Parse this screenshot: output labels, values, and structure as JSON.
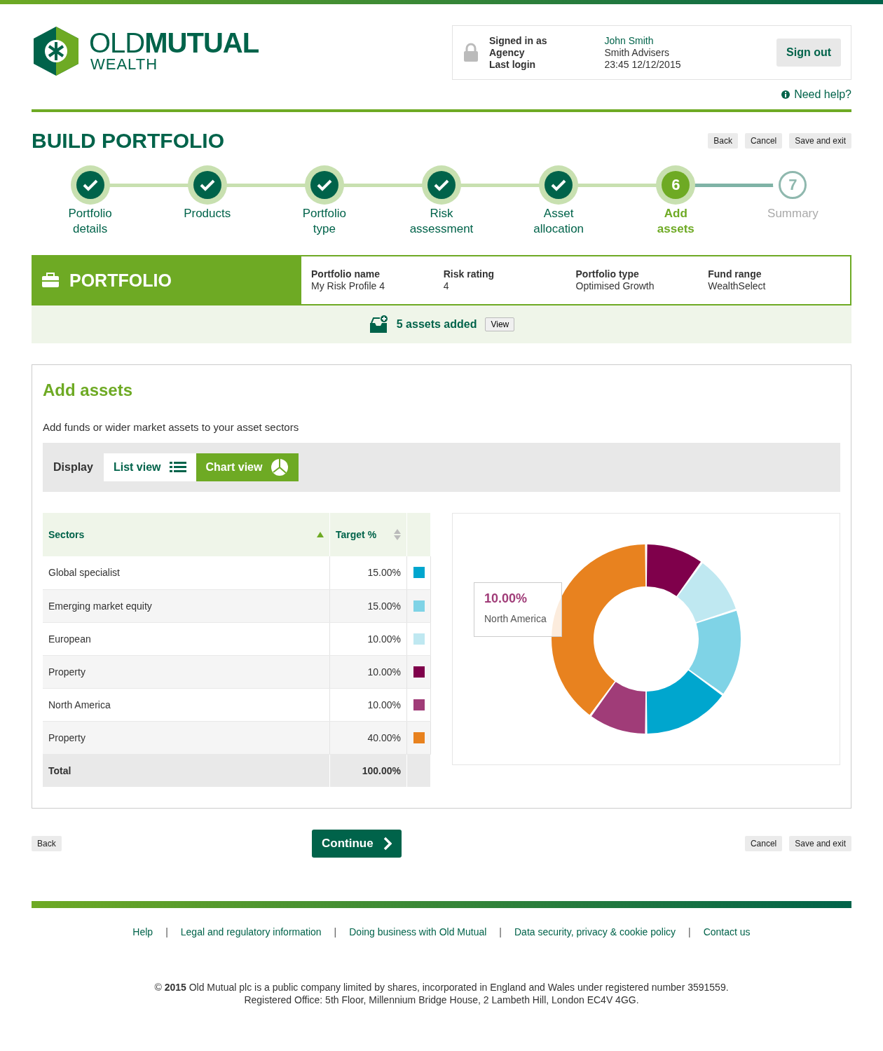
{
  "logo": {
    "wordmark": "OLD**MUTUAL**",
    "sub": "WEALTH"
  },
  "account": {
    "labels": [
      "Signed in as",
      "Agency",
      "Last login"
    ],
    "values": [
      "John Smith",
      "Smith Advisers",
      "23:45 12/12/2015"
    ],
    "sign_out": "Sign out"
  },
  "need_help": "Need help?",
  "page_title": "BUILD PORTFOLIO",
  "top_actions": [
    "Back",
    "Cancel",
    "Save and exit"
  ],
  "steps": [
    {
      "label": "Portfolio details",
      "kind": "done"
    },
    {
      "label": "Products",
      "kind": "done"
    },
    {
      "label": "Portfolio type",
      "kind": "done"
    },
    {
      "label": "Risk assessment",
      "kind": "done"
    },
    {
      "label": "Asset allocation",
      "kind": "done"
    },
    {
      "label": "Add assets",
      "number": "6",
      "kind": "current"
    },
    {
      "label": "Summary",
      "number": "7",
      "kind": "upcoming"
    }
  ],
  "portfolio": {
    "title": "PORTFOLIO",
    "fields": [
      {
        "label": "Portfolio name",
        "value": "My Risk Profile 4"
      },
      {
        "label": "Risk rating",
        "value": "4"
      },
      {
        "label": "Portfolio type",
        "value": "Optimised Growth"
      },
      {
        "label": "Fund range",
        "value": "WealthSelect"
      }
    ],
    "assets_added": "5 assets added",
    "view": "View"
  },
  "add_assets": {
    "title": "Add assets",
    "intro": "Add funds or wider market assets to your asset sectors",
    "display_label": "Display",
    "views": [
      {
        "label": "List view",
        "kind": "list",
        "selected": false
      },
      {
        "label": "Chart view",
        "kind": "chart",
        "selected": true
      }
    ],
    "table": {
      "columns": [
        "Sectors",
        "Target %"
      ],
      "rows": [
        {
          "sector": "Global specialist",
          "target": "15.00%",
          "color": "#00a6ce"
        },
        {
          "sector": "Emerging market equity",
          "target": "15.00%",
          "color": "#7fd3e6"
        },
        {
          "sector": "European",
          "target": "10.00%",
          "color": "#bfe8f1"
        },
        {
          "sector": "Property",
          "target": "10.00%",
          "color": "#7f004b"
        },
        {
          "sector": "North America",
          "target": "10.00%",
          "color": "#a03c78"
        },
        {
          "sector": "Property",
          "target": "40.00%",
          "color": "#e8821f"
        }
      ],
      "total": {
        "label": "Total",
        "value": "100.00%"
      }
    },
    "chart_data": {
      "type": "donut",
      "values": [
        10,
        10,
        15,
        15,
        10,
        40
      ],
      "colors": [
        "#7f004b",
        "#bfe8f1",
        "#7fd3e6",
        "#00a6ce",
        "#a03c78",
        "#e8821f"
      ]
    },
    "tooltip": {
      "value": "10.00%",
      "label": "North America"
    }
  },
  "bottom_actions": {
    "back": "Back",
    "continue": "Continue",
    "cancel": "Cancel",
    "save": "Save and exit"
  },
  "footer_links": [
    {
      "kind": "link",
      "text": "Help"
    },
    {
      "kind": "separator",
      "text": "|"
    },
    {
      "kind": "link",
      "text": "Legal and regulatory information"
    },
    {
      "kind": "separator",
      "text": "|"
    },
    {
      "kind": "link",
      "text": "Doing business with Old Mutual"
    },
    {
      "kind": "separator",
      "text": "|"
    },
    {
      "kind": "link",
      "text": "Data security, privacy & cookie policy"
    },
    {
      "kind": "separator",
      "text": "|"
    },
    {
      "kind": "link",
      "text": "Contact us"
    }
  ],
  "copyright": [
    "© **2015** Old Mutual plc is a public company limited by shares, incorporated in England and Wales under registered number 3591559.",
    "Registered Office: 5th Floor, Millennium Bridge House, 2 Lambeth Hill, London EC4V 4GG."
  ]
}
